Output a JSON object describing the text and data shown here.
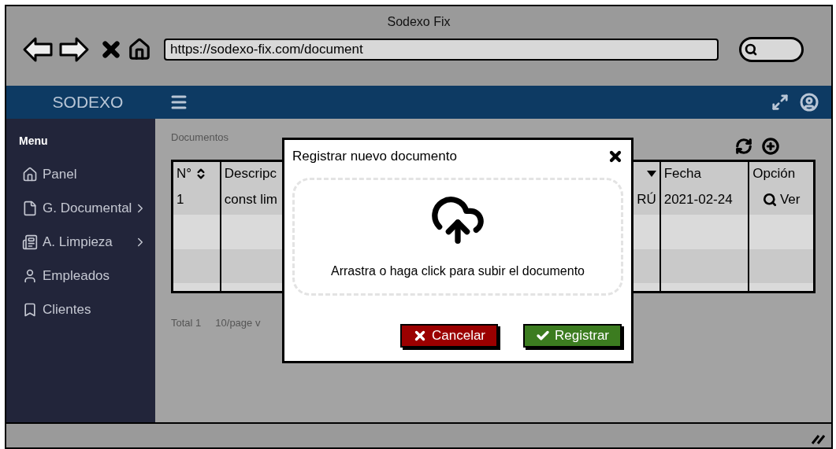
{
  "window": {
    "title": "Sodexo Fix"
  },
  "browser": {
    "url": "https://sodexo-fix.com/document"
  },
  "header": {
    "brand": "SODEXO"
  },
  "sidebar": {
    "heading": "Menu",
    "items": [
      {
        "label": "Panel",
        "has_submenu": false
      },
      {
        "label": "G. Documental",
        "has_submenu": true
      },
      {
        "label": "A. Limpieza",
        "has_submenu": true
      },
      {
        "label": "Empleados",
        "has_submenu": false
      },
      {
        "label": "Clientes",
        "has_submenu": false
      }
    ]
  },
  "page": {
    "breadcrumb": "Documentos"
  },
  "table": {
    "columns": [
      {
        "label": "N°",
        "sortable": true
      },
      {
        "label": "Descripc",
        "sortable": false
      },
      {
        "sortable": false,
        "filter": true
      },
      {
        "label": "Fecha",
        "sortable": false
      },
      {
        "label": "Opción",
        "sortable": false
      }
    ],
    "rows": [
      {
        "cells": [
          "1",
          "const lim",
          "RÚ",
          "2021-02-24"
        ],
        "action": "Ver"
      }
    ]
  },
  "pagination": {
    "total": "Total 1",
    "page_size": "10/page v"
  },
  "dialog": {
    "title": "Registrar nuevo documento",
    "dropzone_text": "Arrastra o haga click para subir el documento",
    "buttons": [
      {
        "label": "Cancelar",
        "kind": "cancel"
      },
      {
        "label": "Registrar",
        "kind": "confirm"
      }
    ]
  }
}
